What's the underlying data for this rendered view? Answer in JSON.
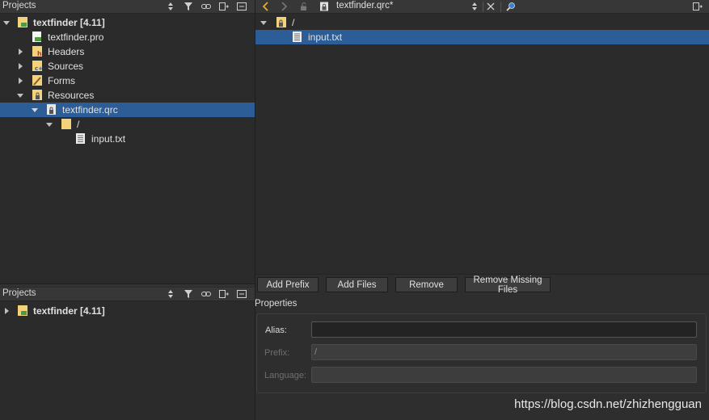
{
  "top_panel": {
    "title": "Projects",
    "tree": [
      {
        "label": "textfinder [4.11]",
        "bold": true
      },
      {
        "label": "textfinder.pro"
      },
      {
        "label": "Headers"
      },
      {
        "label": "Sources"
      },
      {
        "label": "Forms"
      },
      {
        "label": "Resources"
      },
      {
        "label": "textfinder.qrc",
        "selected": true
      },
      {
        "label": "/"
      },
      {
        "label": "input.txt"
      }
    ]
  },
  "bottom_panel": {
    "title": "Projects",
    "tree": [
      {
        "label": "textfinder [4.11]",
        "bold": true
      }
    ]
  },
  "editor": {
    "document_name": "textfinder.qrc*",
    "tree": [
      {
        "label": "/"
      },
      {
        "label": "input.txt",
        "selected": true
      }
    ],
    "buttons": {
      "add_prefix": "Add Prefix",
      "add_files": "Add Files",
      "remove": "Remove",
      "remove_missing": "Remove Missing Files"
    },
    "properties": {
      "title": "Properties",
      "alias_label": "Alias:",
      "alias_value": "",
      "prefix_label": "Prefix:",
      "prefix_value": "/",
      "language_label": "Language:",
      "language_value": ""
    }
  },
  "watermark": "https://blog.csdn.net/zhizhengguan",
  "colors": {
    "selection": "#2c5d96",
    "folder": "#f3d27a",
    "background": "#2b2b2b"
  }
}
